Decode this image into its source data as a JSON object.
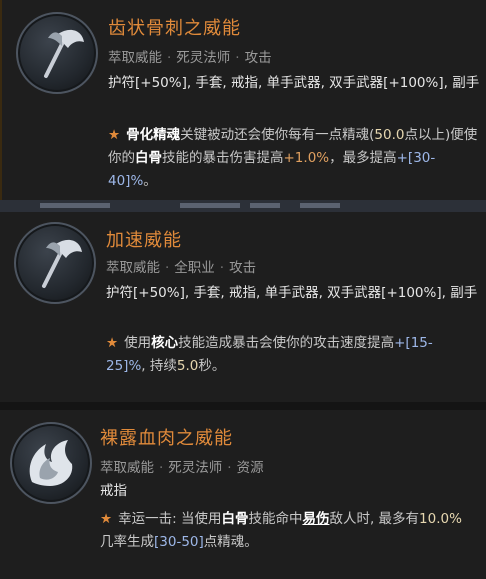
{
  "aspects": [
    {
      "title": "齿状骨刺之威能",
      "meta": [
        "萃取威能",
        "死灵法师",
        "攻击"
      ],
      "slots": "护符[+50%], 手套, 戒指, 单手武器, 双手武器[+100%], 副手",
      "effect": {
        "star": "★",
        "p1": "骨化精魂",
        "p2": "关键被动还会使你每有一点精魂(",
        "p3": "50.0",
        "p4": "点以上)便使你的",
        "p5": "白骨",
        "p6": "技能的暴击伤害提高",
        "p7": "+1.0%",
        "p8": "，最多提高",
        "p9": "+[30-40]%",
        "p10": "。"
      },
      "icon": "axe-icon"
    },
    {
      "title": "加速威能",
      "meta": [
        "萃取威能",
        "全职业",
        "攻击"
      ],
      "slots": "护符[+50%], 手套, 戒指, 单手武器, 双手武器[+100%], 副手",
      "effect": {
        "star": "★",
        "p1": "使用",
        "p2": "核心",
        "p3": "技能造成暴击会使你的攻击速度提高",
        "p4": "+[15-25]%",
        "p5": ", 持续",
        "p6": "5.0",
        "p7": "秒。"
      },
      "icon": "axe-icon"
    },
    {
      "title": "裸露血肉之威能",
      "meta": [
        "萃取威能",
        "死灵法师",
        "资源"
      ],
      "slots": "戒指",
      "effect": {
        "star": "★",
        "p1": "幸运一击: 当使用",
        "p2": "白骨",
        "p3": "技能命中",
        "p4": "易伤",
        "p5": "敌人时, 最多有",
        "p6": "10.0%",
        "p7": "几率生成",
        "p8": "[30-50]",
        "p9": "点精魂。"
      },
      "icon": "flame-wing-icon"
    }
  ]
}
